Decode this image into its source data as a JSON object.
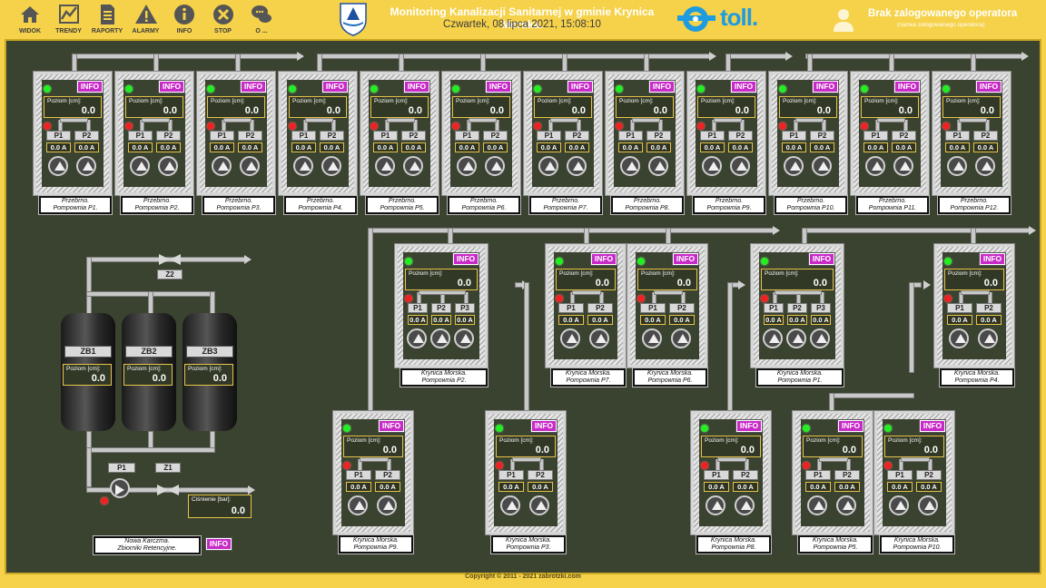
{
  "toolbar": [
    {
      "label": "WIDOK",
      "icon": "home-icon"
    },
    {
      "label": "TRENDY",
      "icon": "chart-icon"
    },
    {
      "label": "RAPORTY",
      "icon": "document-icon"
    },
    {
      "label": "ALARMY",
      "icon": "warning-icon"
    },
    {
      "label": "INFO",
      "icon": "info-icon"
    },
    {
      "label": "STOP",
      "icon": "stop-icon"
    },
    {
      "label": "O ...",
      "icon": "chat-icon"
    }
  ],
  "header": {
    "title": "Monitoring Kanalizacji Sanitarnej w gminie Krynica Morska.",
    "datetime": "Czwartek, 08 lipca 2021, 15:08:10",
    "logo_text": "toll.",
    "login_main": "Brak zalogowanego operatora",
    "login_sub": "(nazwa zalogowanego operatora)"
  },
  "footer": "Copyright © 2011 - 2021 zabrotzki.com",
  "common": {
    "info": "INFO",
    "level_label": "Poziom [cm]:",
    "pressure_label": "Ciśnienie [bar]:"
  },
  "stations_row1": [
    {
      "l1": "Przebrno.",
      "l2": "Pompownia P1.",
      "level": "0.0",
      "pumps": [
        "P1",
        "P2"
      ],
      "currents": [
        "0.0 A",
        "0.0 A"
      ]
    },
    {
      "l1": "Przebrno.",
      "l2": "Pompownia P2.",
      "level": "0.0",
      "pumps": [
        "P1",
        "P2"
      ],
      "currents": [
        "0.0 A",
        "0.0 A"
      ]
    },
    {
      "l1": "Przebrno.",
      "l2": "Pompownia P3.",
      "level": "0.0",
      "pumps": [
        "P1",
        "P2"
      ],
      "currents": [
        "0.0 A",
        "0.0 A"
      ]
    },
    {
      "l1": "Przebrno.",
      "l2": "Pompownia P4.",
      "level": "0.0",
      "pumps": [
        "P1",
        "P2"
      ],
      "currents": [
        "0.0 A",
        "0.0 A"
      ]
    },
    {
      "l1": "Przebrno.",
      "l2": "Pompownia P5.",
      "level": "0.0",
      "pumps": [
        "P1",
        "P2"
      ],
      "currents": [
        "0.0 A",
        "0.0 A"
      ]
    },
    {
      "l1": "Przebrno.",
      "l2": "Pompownia P6.",
      "level": "0.0",
      "pumps": [
        "P1",
        "P2"
      ],
      "currents": [
        "0.0 A",
        "0.0 A"
      ]
    },
    {
      "l1": "Przebrno.",
      "l2": "Pompownia P7.",
      "level": "0.0",
      "pumps": [
        "P1",
        "P2"
      ],
      "currents": [
        "0.0 A",
        "0.0 A"
      ]
    },
    {
      "l1": "Przebrno.",
      "l2": "Pompownia P8.",
      "level": "0.0",
      "pumps": [
        "P1",
        "P2"
      ],
      "currents": [
        "0.0 A",
        "0.0 A"
      ]
    },
    {
      "l1": "Przebrno.",
      "l2": "Pompownia P9.",
      "level": "0.0",
      "pumps": [
        "P1",
        "P2"
      ],
      "currents": [
        "0.0 A",
        "0.0 A"
      ]
    },
    {
      "l1": "Przebrno.",
      "l2": "Pompownia P10.",
      "level": "0.0",
      "pumps": [
        "P1",
        "P2"
      ],
      "currents": [
        "0.0 A",
        "0.0 A"
      ]
    },
    {
      "l1": "Przebrno.",
      "l2": "Pompownia P11.",
      "level": "0.0",
      "pumps": [
        "P1",
        "P2"
      ],
      "currents": [
        "0.0 A",
        "0.0 A"
      ]
    },
    {
      "l1": "Przebrno.",
      "l2": "Pompownia P12.",
      "level": "0.0",
      "pumps": [
        "P1",
        "P2"
      ],
      "currents": [
        "0.0 A",
        "0.0 A"
      ]
    }
  ],
  "stations_mid": [
    {
      "l1": "Krynica Morska.",
      "l2": "Pompownia P2.",
      "level": "0.0",
      "pumps": [
        "P1",
        "P2",
        "P3"
      ],
      "currents": [
        "0.0 A",
        "0.0 A",
        "0.0 A"
      ]
    },
    {
      "l1": "Krynica Morska.",
      "l2": "Pompownia P7.",
      "level": "0.0",
      "pumps": [
        "P1",
        "P2"
      ],
      "currents": [
        "0.0 A",
        "0.0 A"
      ]
    },
    {
      "l1": "Krynica Morska.",
      "l2": "Pompownia P6.",
      "level": "0.0",
      "pumps": [
        "P1",
        "P2"
      ],
      "currents": [
        "0.0 A",
        "0.0 A"
      ]
    },
    {
      "l1": "Krynica Morska.",
      "l2": "Pompownia P1.",
      "level": "0.0",
      "pumps": [
        "P1",
        "P2",
        "P3"
      ],
      "currents": [
        "0.0 A",
        "0.0 A",
        "0.0 A"
      ]
    },
    {
      "l1": "Krynica Morska.",
      "l2": "Pompownia P4.",
      "level": "0.0",
      "pumps": [
        "P1",
        "P2"
      ],
      "currents": [
        "0.0 A",
        "0.0 A"
      ]
    }
  ],
  "stations_low": [
    {
      "l1": "Krynica Morska.",
      "l2": "Pompownia P9.",
      "level": "0.0",
      "pumps": [
        "P1",
        "P2"
      ],
      "currents": [
        "0.0 A",
        "0.0 A"
      ]
    },
    {
      "l1": "Krynica Morska.",
      "l2": "Pompownia P3.",
      "level": "0.0",
      "pumps": [
        "P1",
        "P2"
      ],
      "currents": [
        "0.0 A",
        "0.0 A"
      ]
    },
    {
      "l1": "Krynica Morska.",
      "l2": "Pompownia P8.",
      "level": "0.0",
      "pumps": [
        "P1",
        "P2"
      ],
      "currents": [
        "0.0 A",
        "0.0 A"
      ]
    },
    {
      "l1": "Krynica Morska.",
      "l2": "Pompownia P5.",
      "level": "0.0",
      "pumps": [
        "P1",
        "P2"
      ],
      "currents": [
        "0.0 A",
        "0.0 A"
      ]
    },
    {
      "l1": "Krynica Morska.",
      "l2": "Pompownia P10.",
      "level": "0.0",
      "pumps": [
        "P1",
        "P2"
      ],
      "currents": [
        "0.0 A",
        "0.0 A"
      ]
    }
  ],
  "tanks": [
    {
      "name": "ZB1",
      "level": "0.0"
    },
    {
      "name": "ZB2",
      "level": "0.0"
    },
    {
      "name": "ZB3",
      "level": "0.0"
    }
  ],
  "retention": {
    "valve_top": "Z2",
    "pump": "P1",
    "valve_bottom": "Z1",
    "pressure": "0.0",
    "l1": "Nowa Karczma.",
    "l2": "Zbiorniki Retencyjne."
  }
}
